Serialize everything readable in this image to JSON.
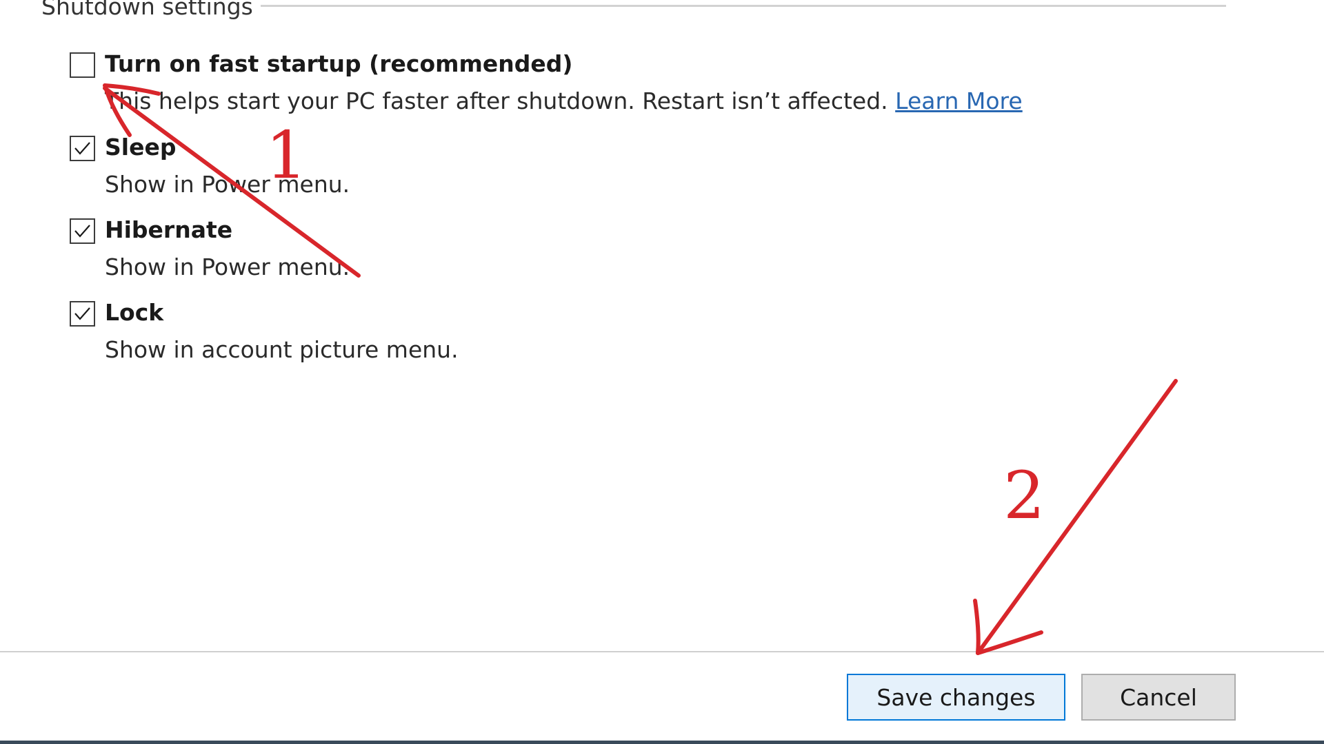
{
  "section": {
    "title": "Shutdown settings"
  },
  "options": [
    {
      "title": "Turn on fast startup (recommended)",
      "description": "This helps start your PC faster after shutdown. Restart isn’t affected.",
      "link": "Learn More",
      "checked": false
    },
    {
      "title": "Sleep",
      "description": "Show in Power menu.",
      "checked": true
    },
    {
      "title": "Hibernate",
      "description": "Show in Power menu.",
      "checked": true
    },
    {
      "title": "Lock",
      "description": "Show in account picture menu.",
      "checked": true
    }
  ],
  "buttons": {
    "save": "Save changes",
    "cancel": "Cancel"
  },
  "annotations": {
    "step_1": "1",
    "step_2": "2",
    "color": "#d8262b"
  },
  "icons": {
    "checkmark": "check-icon"
  }
}
